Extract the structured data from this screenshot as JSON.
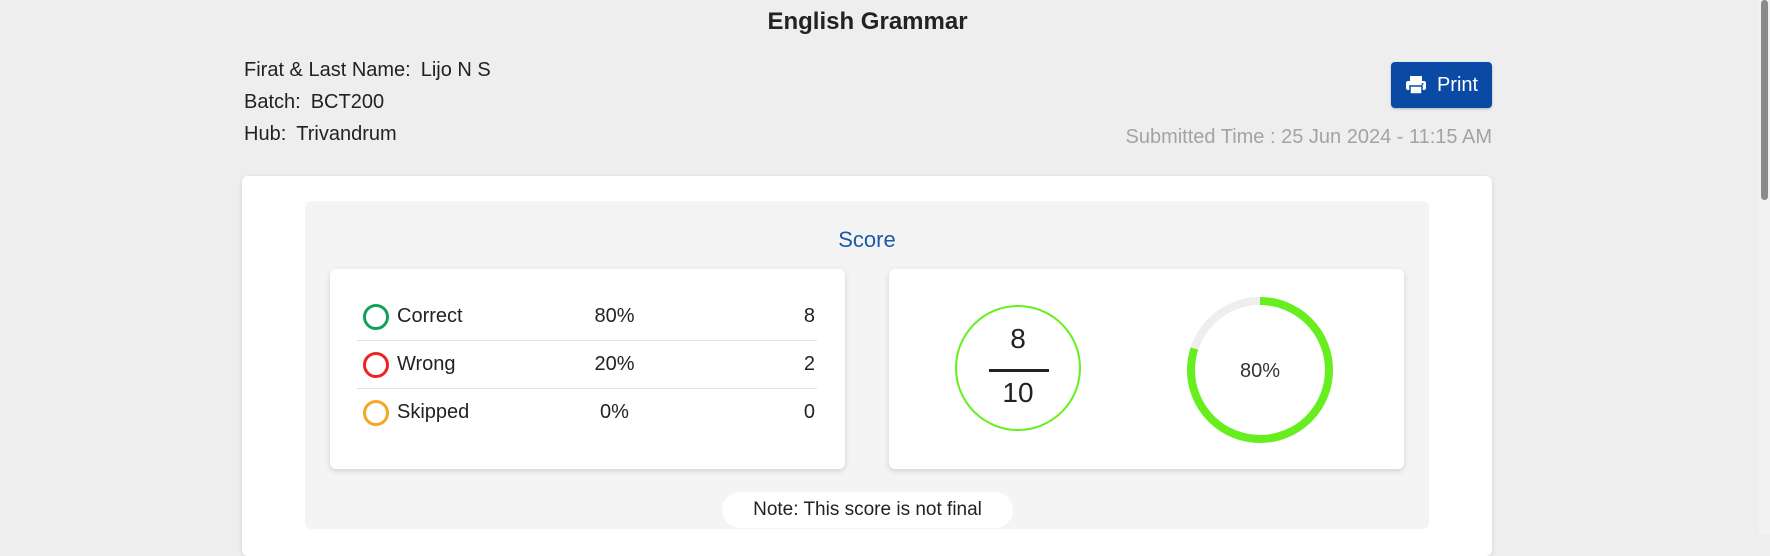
{
  "header": {
    "title": "English Grammar"
  },
  "student": {
    "name_label": "Firat & Last Name:",
    "name_value": "Lijo N S",
    "batch_label": "Batch:",
    "batch_value": "BCT200",
    "hub_label": "Hub:",
    "hub_value": "Trivandrum"
  },
  "toolbar": {
    "print_label": "Print",
    "print_icon": "printer-icon",
    "accent": "#0a4aa4"
  },
  "submitted": "Submitted Time : 25 Jun 2024 - 11:15 AM",
  "score": {
    "title": "Score",
    "rows": [
      {
        "label": "Correct",
        "percent": "80%",
        "count": "8",
        "color": "#14a05a"
      },
      {
        "label": "Wrong",
        "percent": "20%",
        "count": "2",
        "color": "#ee2222"
      },
      {
        "label": "Skipped",
        "percent": "0%",
        "count": "0",
        "color": "#f5a623"
      }
    ],
    "numerator": "8",
    "denominator": "10",
    "ring_label": "80%",
    "ring_fraction": 0.8,
    "ring_color": "#66ee1f",
    "note": "Note: This score is not final"
  }
}
